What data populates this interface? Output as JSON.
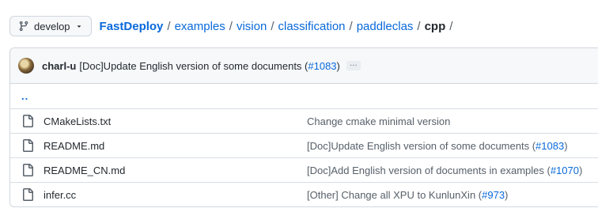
{
  "branch": {
    "label": "develop",
    "icon": "git-branch-icon",
    "dropdown_icon": "triangle-down-icon"
  },
  "breadcrumb": {
    "repo": "FastDeploy",
    "path": [
      "examples",
      "vision",
      "classification",
      "paddleclas"
    ],
    "current": "cpp",
    "separator": "/"
  },
  "latest_commit": {
    "author": "charl-u",
    "message_prefix": "[Doc]Update English version of some documents (",
    "pr": "#1083",
    "message_suffix": ")",
    "ellipsis": "…"
  },
  "parent_dir": "..",
  "files": [
    {
      "name": "CMakeLists.txt",
      "icon": "file-icon",
      "msg_prefix": "Change cmake minimal version",
      "pr": "",
      "msg_suffix": ""
    },
    {
      "name": "README.md",
      "icon": "file-icon",
      "msg_prefix": "[Doc]Update English version of some documents (",
      "pr": "#1083",
      "msg_suffix": ")"
    },
    {
      "name": "README_CN.md",
      "icon": "file-icon",
      "msg_prefix": "[Doc]Add English version of documents in examples (",
      "pr": "#1070",
      "msg_suffix": ")"
    },
    {
      "name": "infer.cc",
      "icon": "file-icon",
      "msg_prefix": "[Other] Change all XPU to KunlunXin (",
      "pr": "#973",
      "msg_suffix": ")"
    }
  ],
  "colors": {
    "link": "#0969da",
    "text": "#24292f",
    "muted": "#57606a",
    "border": "#d0d7de",
    "header_bg": "#f6f8fa"
  }
}
